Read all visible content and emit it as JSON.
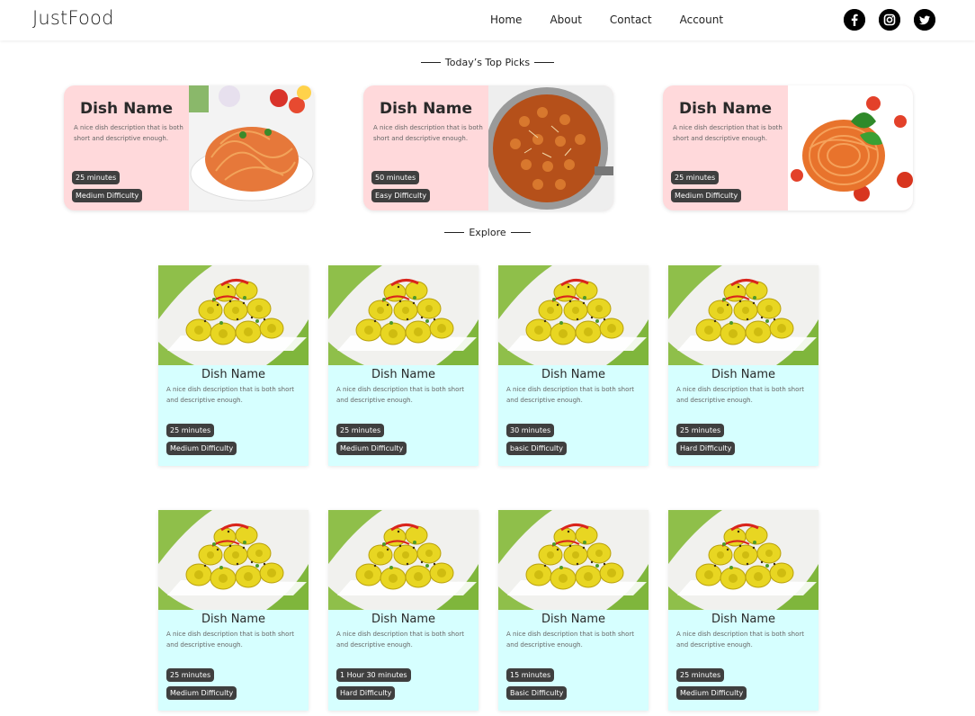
{
  "header": {
    "logo": "JustFood",
    "nav": [
      "Home",
      "About",
      "Contact",
      "Account"
    ],
    "social": [
      "facebook-icon",
      "instagram-icon",
      "twitter-icon"
    ]
  },
  "sections": {
    "top_picks": "Today’s Top Picks",
    "explore": "Explore"
  },
  "top_picks": [
    {
      "title": "Dish Name",
      "desc": "A nice dish description that is both short and descriptive enough.",
      "time": "25 minutes",
      "difficulty": "Medium Difficulty",
      "image": "spaghetti-bowl"
    },
    {
      "title": "Dish Name",
      "desc": "A nice dish description that is both short and descriptive enough.",
      "time": "50 minutes",
      "difficulty": "Easy Difficulty",
      "image": "chickpea-curry-pot"
    },
    {
      "title": "Dish Name",
      "desc": "A nice dish description that is both short and descriptive enough.",
      "time": "25 minutes",
      "difficulty": "Medium Difficulty",
      "image": "spaghetti-basil"
    }
  ],
  "explore": [
    {
      "title": "Dish Name",
      "desc": "A nice dish description that is both short and descriptive enough.",
      "time": "25 minutes",
      "difficulty": "Medium Difficulty"
    },
    {
      "title": "Dish Name",
      "desc": "A nice dish description that is both short and descriptive enough.",
      "time": "25 minutes",
      "difficulty": "Medium Difficulty"
    },
    {
      "title": "Dish Name",
      "desc": "A nice dish description that is both short and descriptive enough.",
      "time": "30 minutes",
      "difficulty": "basic Difficulty"
    },
    {
      "title": "Dish Name",
      "desc": "A nice dish description that is both short and descriptive enough.",
      "time": "25 minutes",
      "difficulty": "Hard Difficulty"
    },
    {
      "title": "Dish Name",
      "desc": "A nice dish description that is both short and descriptive enough.",
      "time": "25 minutes",
      "difficulty": "Medium Difficulty"
    },
    {
      "title": "Dish Name",
      "desc": "A nice dish description that is both short and descriptive enough.",
      "time": "1 Hour 30 minutes",
      "difficulty": "Hard Difficulty"
    },
    {
      "title": "Dish Name",
      "desc": "A nice dish description that is both short and descriptive enough.",
      "time": "15 minutes",
      "difficulty": "Basic Difficulty"
    },
    {
      "title": "Dish Name",
      "desc": "A nice dish description that is both short and descriptive enough.",
      "time": "25 minutes",
      "difficulty": "Medium Difficulty"
    }
  ],
  "colors": {
    "pick_bg": "#ffd9db",
    "card_bg": "#d6ffff",
    "badge_bg": "#3f3f3f"
  }
}
